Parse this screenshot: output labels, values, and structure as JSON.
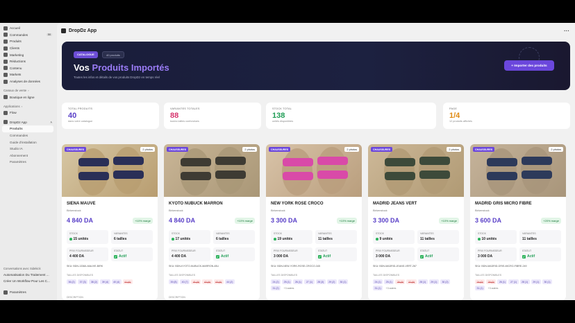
{
  "sidebar": {
    "items": [
      {
        "label": "Accueil",
        "icon": "home-icon"
      },
      {
        "label": "Commandes",
        "icon": "orders-icon",
        "badge": "50"
      },
      {
        "label": "Produits",
        "icon": "tag-icon"
      },
      {
        "label": "Clients",
        "icon": "person-icon"
      },
      {
        "label": "Marketing",
        "icon": "target-icon"
      },
      {
        "label": "Réductions",
        "icon": "discount-icon"
      },
      {
        "label": "Contenu",
        "icon": "content-icon"
      },
      {
        "label": "Markets",
        "icon": "globe-icon"
      },
      {
        "label": "Analyses de données",
        "icon": "chart-icon"
      }
    ],
    "sales_channels_label": "Canaux de vente",
    "online_store": "Boutique en ligne",
    "applications_label": "Applications",
    "flow": "Flow",
    "app_name": "DropDz App",
    "app_sub": [
      {
        "label": "Produits",
        "active": true
      },
      {
        "label": "Commandes"
      },
      {
        "label": "Guide d'installation"
      },
      {
        "label": "Studio IA"
      },
      {
        "label": "Abonnement"
      },
      {
        "label": "Paramètres"
      }
    ],
    "conversations_label": "Conversations avec Sidekick",
    "conversations": [
      "Automatisation Du Traitement ...",
      "Créer Un Workflow Pour Les C..."
    ],
    "settings": "Paramètres"
  },
  "appbar": {
    "title": "DropDz App",
    "menu": "···"
  },
  "hero": {
    "tag": "CATALOGUE",
    "count_tag": "40 produits",
    "title_plain": "Vos ",
    "title_accent": "Produits Importés",
    "subtitle": "Toutes les infos et détails de vos produits DropDz en temps réel",
    "button": "+ Importer des produits"
  },
  "stats": [
    {
      "label": "TOTAL PRODUITS",
      "value": "40",
      "sub": "dans votre catalogue",
      "color": "#5a40c8"
    },
    {
      "label": "VARIANTES TOTALES",
      "value": "88",
      "sub": "toutes tailles confondues",
      "color": "#d6336c"
    },
    {
      "label": "STOCK TOTAL",
      "value": "138",
      "sub": "unités disponibles",
      "color": "#1f9d55"
    },
    {
      "label": "PAGE",
      "value": "1/4",
      "sub": "12 produits affichés",
      "color": "#e08a12"
    }
  ],
  "card_labels": {
    "stock": "STOCK",
    "variantes": "VARIANTES",
    "prix": "PRIX FOURNISSEUR",
    "statut": "STATUT",
    "sku": "SKU:",
    "tailles": "TAILLES DISPONIBLES",
    "description": "DESCRIPTION"
  },
  "products": [
    {
      "category": "CHAUSSURES",
      "photos": "2 photos",
      "name": "SIENA MAUVE",
      "brand": "Birkenstock",
      "price": "4 840 DA",
      "marge": "+10% marge",
      "stock": "15 unités",
      "variantes": "6 tailles",
      "prix": "4 400 DA",
      "statut": "Actif",
      "sku": "BDN-1338A-MAUVE-BIRK",
      "sizes": [
        {
          "t": "36 (2)"
        },
        {
          "t": "37 (3)"
        },
        {
          "t": "38 (2)"
        },
        {
          "t": "39 (4)"
        },
        {
          "t": "40 (4)"
        },
        {
          "t": "41 (0)",
          "out": true
        }
      ],
      "img": [
        "#d7c7a4",
        "#2a2f57",
        "#b89d70"
      ]
    },
    {
      "category": "CHAUSSURES",
      "photos": "2 photos",
      "name": "KYOTO NUBUCK MARRON",
      "brand": "Birkenstock",
      "price": "4 840 DA",
      "marge": "+10% marge",
      "stock": "17 unités",
      "variantes": "6 tailles",
      "prix": "4 400 DA",
      "statut": "Actif",
      "sku": "BDN-KYOTO-NUBUCK-MARRON-45U",
      "sizes": [
        {
          "t": "39 (8)"
        },
        {
          "t": "40 (7)"
        },
        {
          "t": "41 (0)",
          "out": true
        },
        {
          "t": "42 (0)",
          "out": true
        },
        {
          "t": "43 (0)",
          "out": true
        },
        {
          "t": "44 (2)"
        }
      ],
      "img": [
        "#c9b596",
        "#3e3b33",
        "#a99777"
      ]
    },
    {
      "category": "CHAUSSURES",
      "photos": "2 photos",
      "name": "NEW YORK ROSE CROCO",
      "brand": "Birkenstock",
      "price": "3 300 DA",
      "marge": "+10% marge",
      "stock": "19 unités",
      "variantes": "11 tailles",
      "prix": "3 000 DA",
      "statut": "Actif",
      "sku": "BDN-NEW-YORK-ROSE-CROCO-345",
      "sizes": [
        {
          "t": "24 (2)"
        },
        {
          "t": "25 (1)"
        },
        {
          "t": "26 (1)"
        },
        {
          "t": "27 (1)"
        },
        {
          "t": "28 (3)"
        },
        {
          "t": "29 (2)"
        },
        {
          "t": "30 (1)"
        },
        {
          "t": "31 (2)"
        },
        {
          "t": "+3 autres",
          "more": true
        }
      ],
      "img": [
        "#d8c3a8",
        "#d94aa8",
        "#b99e7d"
      ]
    },
    {
      "category": "CHAUSSURES",
      "photos": "2 photos",
      "name": "MADRID JEANS VERT",
      "brand": "Birkenstock",
      "price": "3 300 DA",
      "marge": "+10% marge",
      "stock": "9 unités",
      "variantes": "11 tailles",
      "prix": "3 000 DA",
      "statut": "Actif",
      "sku": "BDN-MADRID-JEANS-VERT-267",
      "sizes": [
        {
          "t": "24 (1)"
        },
        {
          "t": "25 (1)"
        },
        {
          "t": "26 (0)",
          "out": true
        },
        {
          "t": "27 (0)",
          "out": true
        },
        {
          "t": "28 (1)"
        },
        {
          "t": "29 (1)"
        },
        {
          "t": "30 (2)"
        },
        {
          "t": "31 (1)"
        },
        {
          "t": "+3 autres",
          "more": true
        }
      ],
      "img": [
        "#cdb898",
        "#3d4a3a",
        "#b09a74"
      ]
    },
    {
      "category": "CHAUSSURES",
      "photos": "2 photos",
      "name": "MADRID GRIS MICRO FIBRE",
      "brand": "Birkenstock",
      "price": "3 600 DA",
      "marge": "+20% marge",
      "stock": "10 unités",
      "variantes": "11 tailles",
      "prix": "3 000 DA",
      "statut": "Actif",
      "sku": "BDN-MADRID-GRIS-MICRO-FIBRE-249",
      "sizes": [
        {
          "t": "24 (0)",
          "out": true
        },
        {
          "t": "25 (0)",
          "out": true
        },
        {
          "t": "26 (1)"
        },
        {
          "t": "27 (1)"
        },
        {
          "t": "28 (1)"
        },
        {
          "t": "29 (1)"
        },
        {
          "t": "30 (1)"
        },
        {
          "t": "31 (1)"
        },
        {
          "t": "+3 autres",
          "more": true
        }
      ],
      "img": [
        "#c5b39a",
        "#2d3a5a",
        "#a8957a"
      ]
    }
  ]
}
